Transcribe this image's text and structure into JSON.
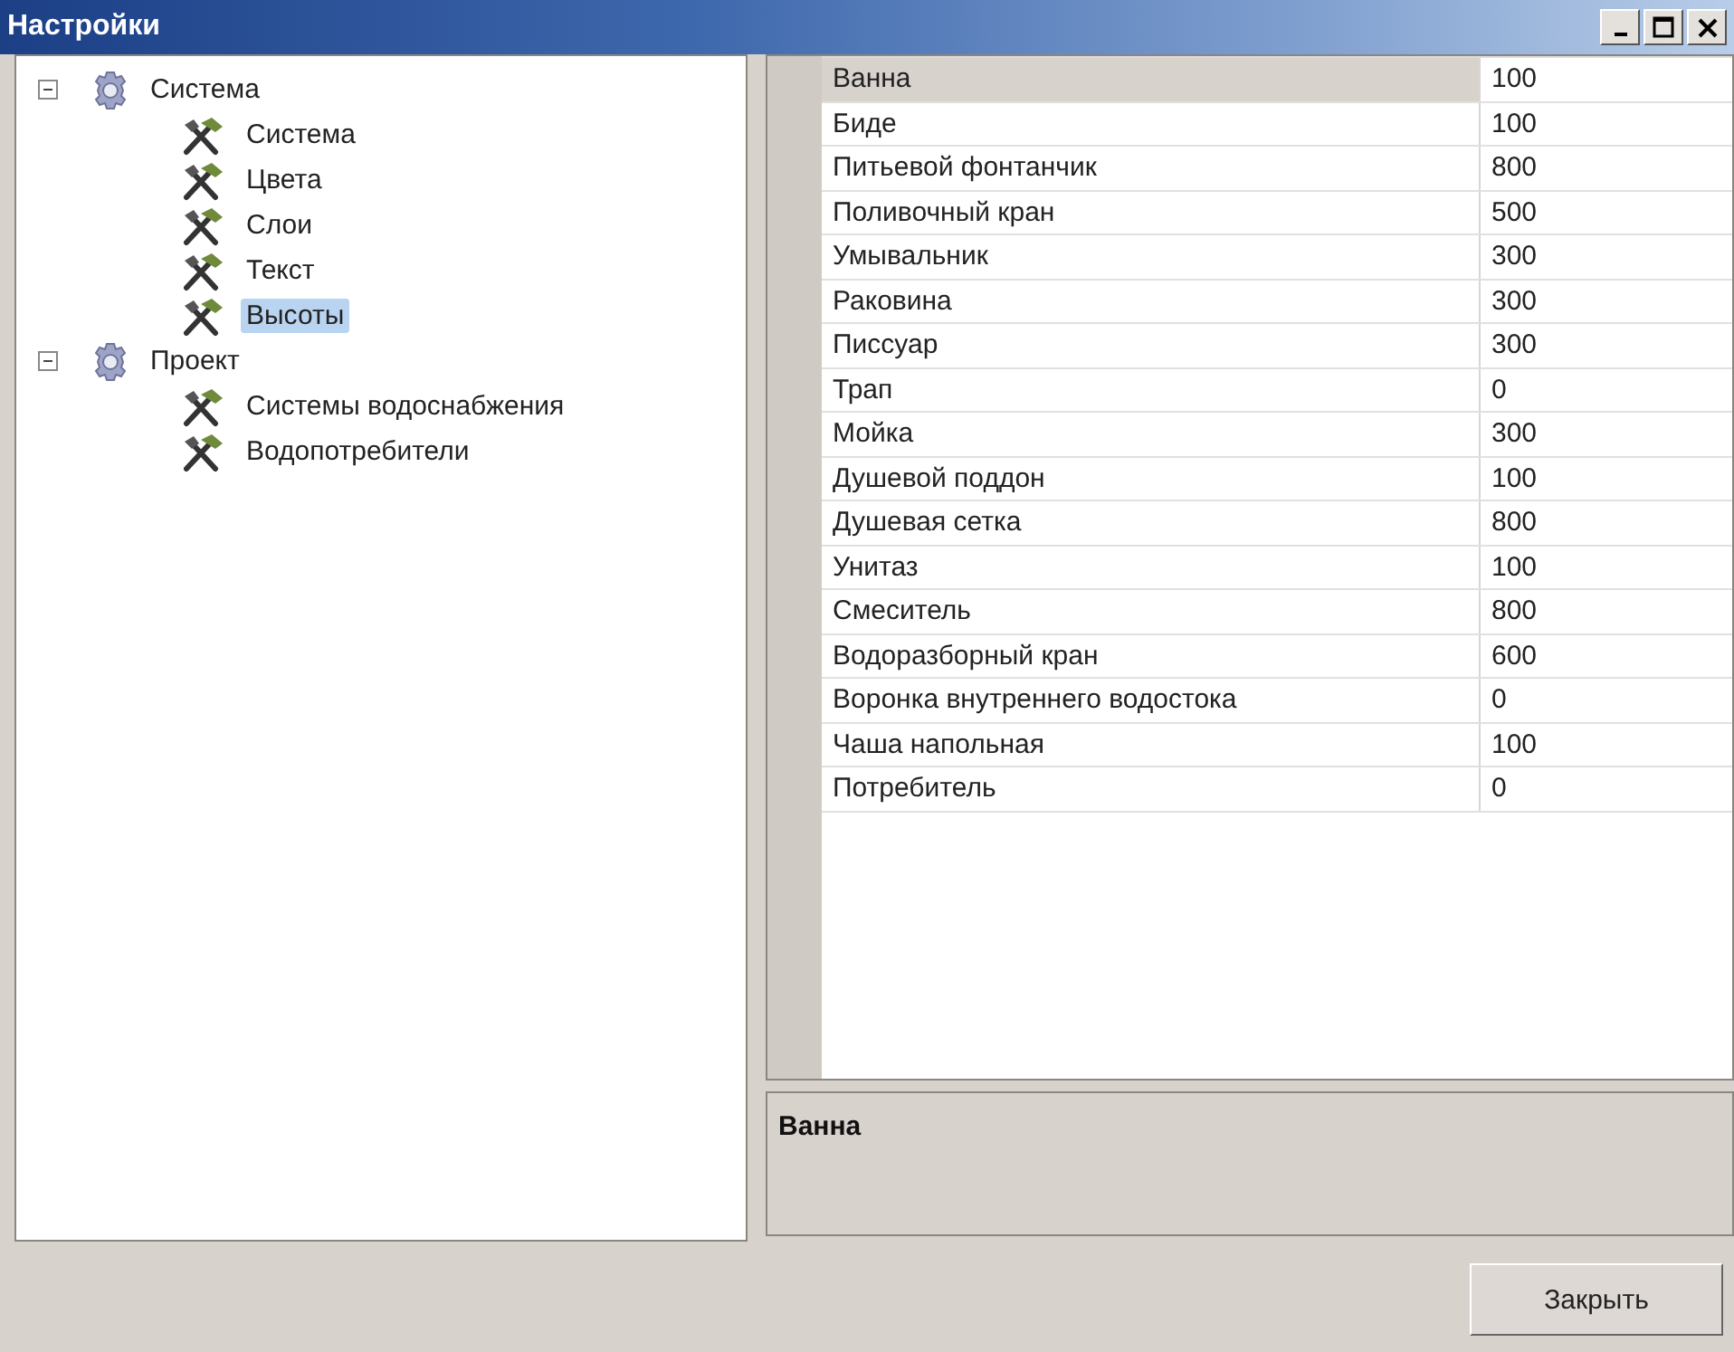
{
  "window": {
    "title": "Настройки"
  },
  "tree": [
    {
      "label": "Система",
      "expanded": true,
      "selected": false,
      "children": [
        {
          "label": "Система",
          "selected": false
        },
        {
          "label": "Цвета",
          "selected": false
        },
        {
          "label": "Слои",
          "selected": false
        },
        {
          "label": "Текст",
          "selected": false
        },
        {
          "label": "Высоты",
          "selected": true
        }
      ]
    },
    {
      "label": "Проект",
      "expanded": true,
      "selected": false,
      "children": [
        {
          "label": "Системы водоснабжения",
          "selected": false
        },
        {
          "label": "Водопотребители",
          "selected": false
        }
      ]
    }
  ],
  "grid": {
    "rows": [
      {
        "name": "Ванна",
        "value": "100",
        "selected": true
      },
      {
        "name": "Биде",
        "value": "100",
        "selected": false
      },
      {
        "name": "Питьевой фонтанчик",
        "value": "800",
        "selected": false
      },
      {
        "name": "Поливочный кран",
        "value": "500",
        "selected": false
      },
      {
        "name": "Умывальник",
        "value": "300",
        "selected": false
      },
      {
        "name": "Раковина",
        "value": "300",
        "selected": false
      },
      {
        "name": "Писсуар",
        "value": "300",
        "selected": false
      },
      {
        "name": "Трап",
        "value": "0",
        "selected": false
      },
      {
        "name": "Мойка",
        "value": "300",
        "selected": false
      },
      {
        "name": "Душевой поддон",
        "value": "100",
        "selected": false
      },
      {
        "name": "Душевая сетка",
        "value": "800",
        "selected": false
      },
      {
        "name": "Унитаз",
        "value": "100",
        "selected": false
      },
      {
        "name": "Смеситель",
        "value": "800",
        "selected": false
      },
      {
        "name": "Водоразборный кран",
        "value": "600",
        "selected": false
      },
      {
        "name": "Воронка внутреннего водостока",
        "value": "0",
        "selected": false
      },
      {
        "name": "Чаша напольная",
        "value": "100",
        "selected": false
      },
      {
        "name": "Потребитель",
        "value": "0",
        "selected": false
      }
    ]
  },
  "description": {
    "title": "Ванна"
  },
  "buttons": [
    {
      "label": "Закрыть"
    }
  ]
}
